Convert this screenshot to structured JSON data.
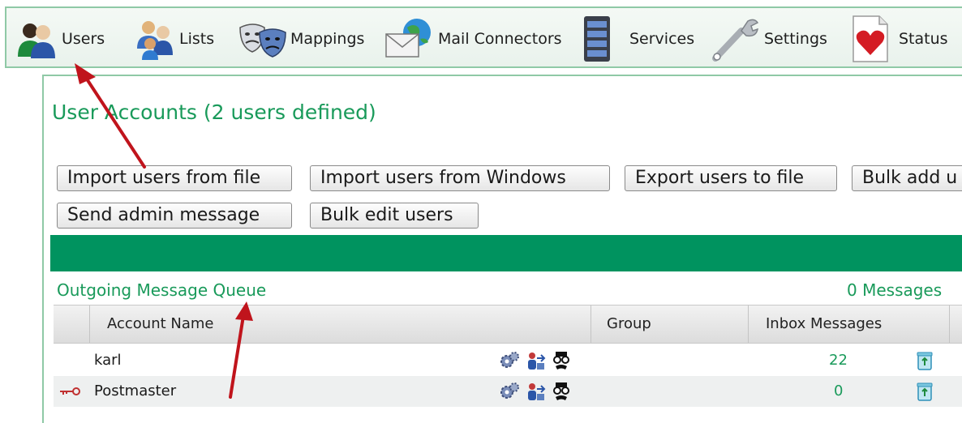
{
  "toolbar": {
    "items": [
      {
        "label": "Users",
        "icon": "users-icon"
      },
      {
        "label": "Lists",
        "icon": "lists-icon"
      },
      {
        "label": "Mappings",
        "icon": "masks-icon"
      },
      {
        "label": "Mail Connectors",
        "icon": "mail-globe-icon"
      },
      {
        "label": "Services",
        "icon": "server-icon"
      },
      {
        "label": "Settings",
        "icon": "wrench-icon"
      },
      {
        "label": "Status",
        "icon": "heart-icon"
      }
    ]
  },
  "page": {
    "title": "User Accounts (2 users defined)"
  },
  "buttons": {
    "import_file": "Import users from file",
    "import_windows": "Import users from Windows",
    "export_file": "Export users to file",
    "bulk_add": "Bulk add u",
    "send_admin": "Send admin message",
    "bulk_edit": "Bulk edit users"
  },
  "queue": {
    "title": "Outgoing Message Queue",
    "count": "0 Messages"
  },
  "table": {
    "headers": {
      "account": "Account Name",
      "group": "Group",
      "inbox": "Inbox Messages"
    },
    "rows": [
      {
        "name": "karl",
        "group": "",
        "inbox": "22",
        "has_key_icon": false
      },
      {
        "name": "Postmaster",
        "group": "",
        "inbox": "0",
        "has_key_icon": true
      }
    ]
  },
  "colors": {
    "accent": "#199a5a",
    "bar": "#00935f",
    "annotation_arrow": "#c0141c"
  }
}
